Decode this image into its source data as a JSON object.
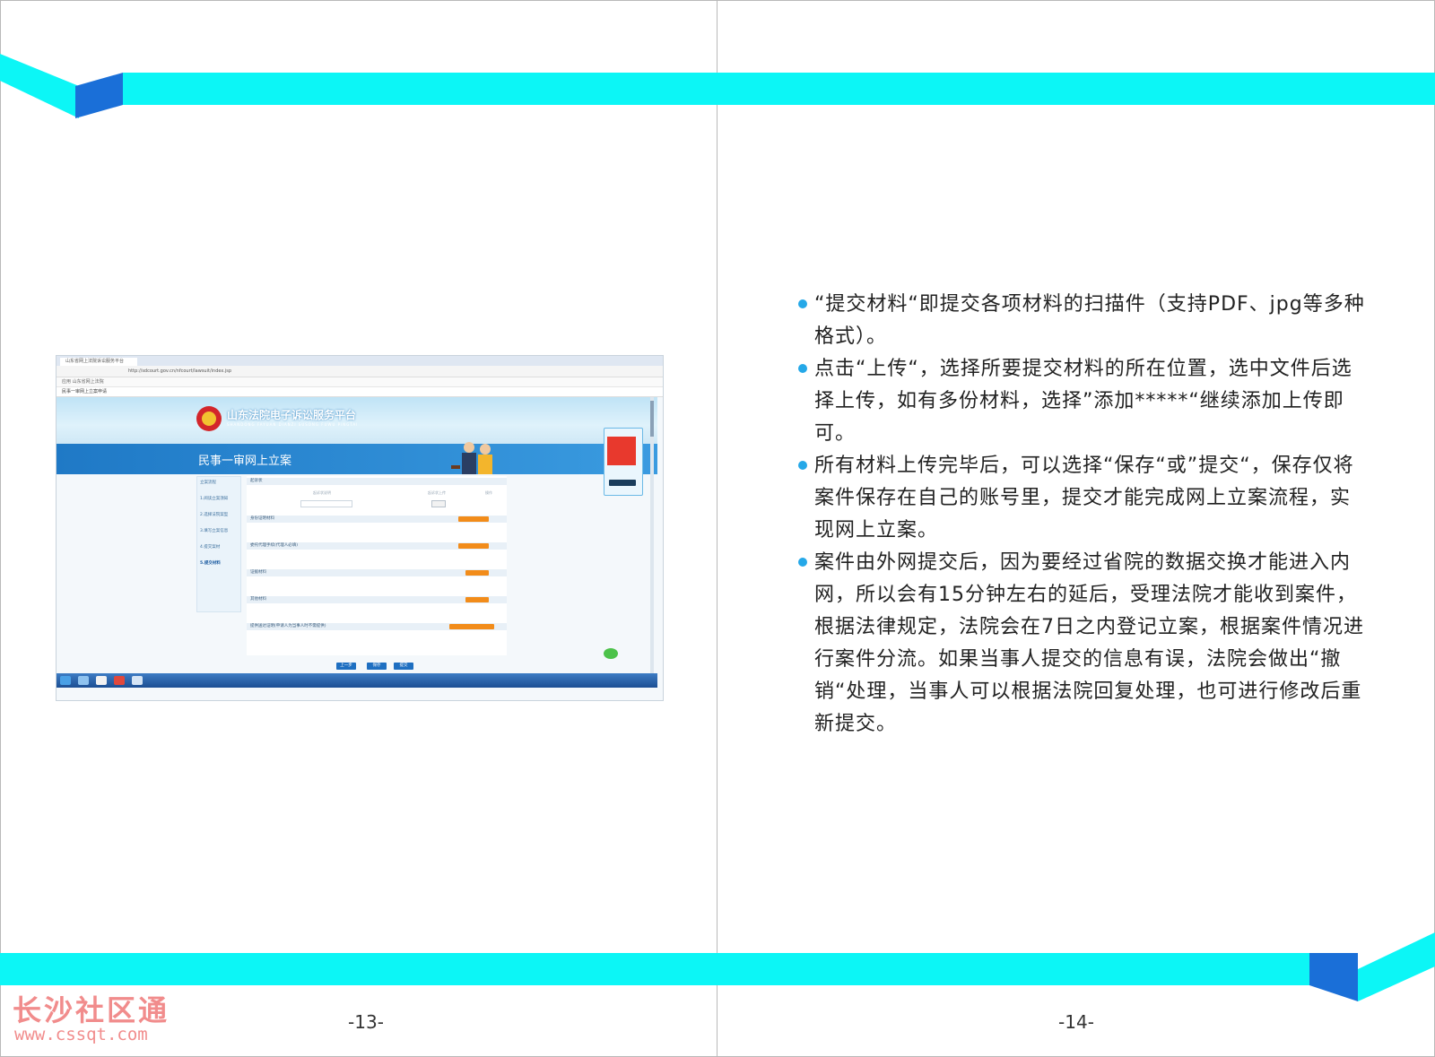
{
  "left_page": {
    "page_number": "-13-",
    "screenshot": {
      "browser_tab": "山东省网上法院诉讼服务平台",
      "url_text": "http://sdcourt.gov.cn/nfcourt/lawsuit/index.jsp",
      "bookmark": "应用  山东省网上法院",
      "window_title": "民事一审网上立案申请",
      "site_title": "山东法院电子诉讼服务平台",
      "site_subtitle": "SHANDONG FAYUAN DIANZI SUSONG FUWU PINGTAI",
      "page_heading": "民事一审网上立案",
      "sidebar_title": "立案流程",
      "sidebar_items": [
        "1.阅读立案须知",
        "2.选择法院案型",
        "3.填写立案信息",
        "4.提交案材",
        "5.提交材料"
      ],
      "sections": [
        {
          "label": "起诉状",
          "button": ""
        },
        {
          "label": "身份证明材料",
          "button": "添加身份证明"
        },
        {
          "label": "委托代理手续(代理人必填)",
          "button": "添加委托代理"
        },
        {
          "label": "证据材料",
          "button": "添加证据"
        },
        {
          "label": "其他材料",
          "button": "添加材料"
        },
        {
          "label": "提供送达证明(申请人为当事人时不需提供)",
          "button": "添加送达地址证明"
        }
      ],
      "buttons": {
        "prev": "上一步",
        "save": "保存",
        "submit": "提交"
      },
      "float_panel": {
        "title": "移动诉讼服务",
        "button": "点击进入"
      }
    },
    "watermark": {
      "name": "长沙社区通",
      "url": "www.cssqt.com"
    }
  },
  "right_page": {
    "page_number": "-14-",
    "paragraphs": [
      "“提交材料“即提交各项材料的扫描件（支持PDF、jpg等多种格式）。",
      "点击“上传“，选择所要提交材料的所在位置，选中文件后选择上传，如有多份材料，选择”添加*****“继续添加上传即可。",
      "所有材料上传完毕后，可以选择“保存“或”提交“，保存仅将案件保存在自己的账号里，提交才能完成网上立案流程，实现网上立案。",
      "案件由外网提交后，因为要经过省院的数据交换才能进入内网，所以会有15分钟左右的延后，受理法院才能收到案件，根据法律规定，法院会在7日之内登记立案，根据案件情况进行案件分流。如果当事人提交的信息有误，法院会做出“撤销“处理，当事人可以根据法院回复处理，也可进行修改后重新提交。"
    ]
  },
  "colors": {
    "band": "#0cf6f6",
    "accent": "#1a6fd8",
    "bullet": "#25a8e8"
  }
}
